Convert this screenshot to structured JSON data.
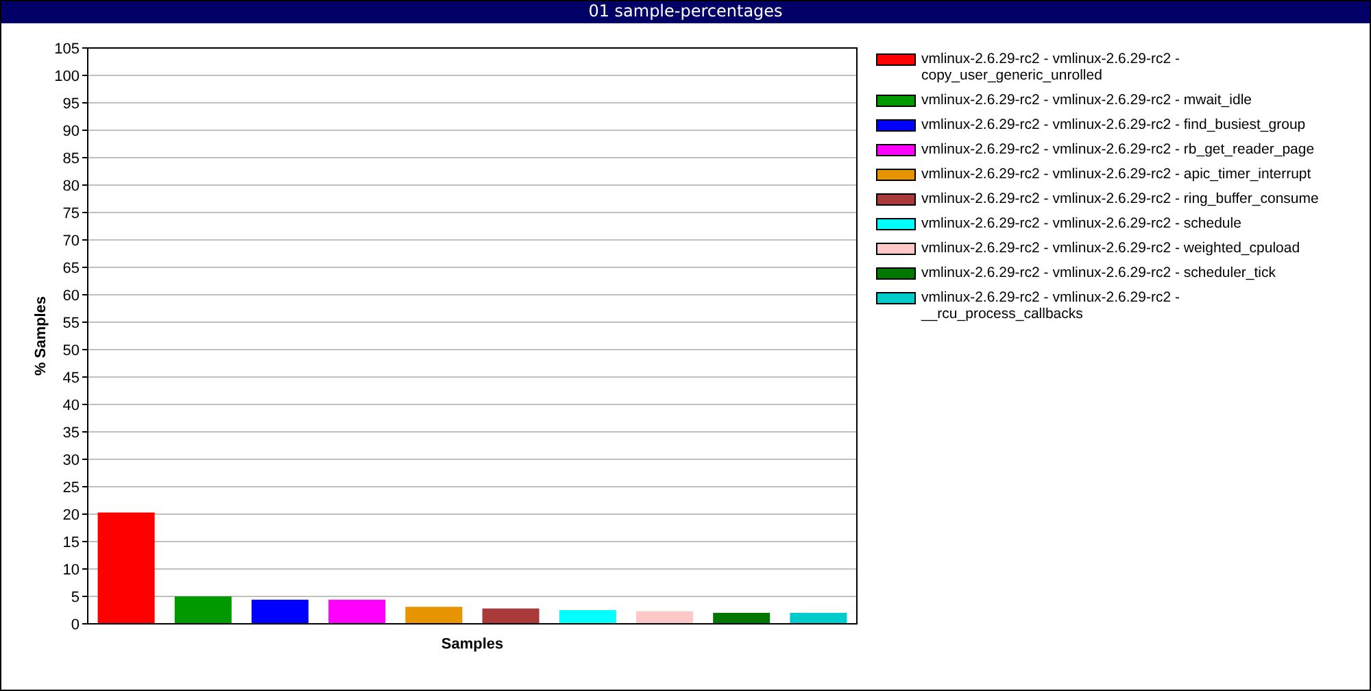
{
  "window": {
    "title": "01 sample-percentages"
  },
  "chart": {
    "chart_data": {
      "type": "bar",
      "grid": true,
      "xlabel": "Samples",
      "ylabel": "% Samples",
      "ylim": [
        0,
        105
      ],
      "yticks": [
        0,
        5,
        10,
        15,
        20,
        25,
        30,
        35,
        40,
        45,
        50,
        55,
        60,
        65,
        70,
        75,
        80,
        85,
        90,
        95,
        100,
        105
      ],
      "series": [
        {
          "name": "vmlinux-2.6.29-rc2 - vmlinux-2.6.29-rc2 - copy_user_generic_unrolled",
          "color": "#ff0000",
          "values": [
            20.3
          ]
        },
        {
          "name": "vmlinux-2.6.29-rc2 - vmlinux-2.6.29-rc2 - mwait_idle",
          "color": "#009900",
          "values": [
            5.0
          ]
        },
        {
          "name": "vmlinux-2.6.29-rc2 - vmlinux-2.6.29-rc2 - find_busiest_group",
          "color": "#0000ff",
          "values": [
            4.4
          ]
        },
        {
          "name": "vmlinux-2.6.29-rc2 - vmlinux-2.6.29-rc2 - rb_get_reader_page",
          "color": "#ff00ff",
          "values": [
            4.4
          ]
        },
        {
          "name": "vmlinux-2.6.29-rc2 - vmlinux-2.6.29-rc2 - apic_timer_interrupt",
          "color": "#e69500",
          "values": [
            3.1
          ]
        },
        {
          "name": "vmlinux-2.6.29-rc2 - vmlinux-2.6.29-rc2 - ring_buffer_consume",
          "color": "#aa3939",
          "values": [
            2.8
          ]
        },
        {
          "name": "vmlinux-2.6.29-rc2 - vmlinux-2.6.29-rc2 - schedule",
          "color": "#00ffff",
          "values": [
            2.5
          ]
        },
        {
          "name": "vmlinux-2.6.29-rc2 - vmlinux-2.6.29-rc2 - weighted_cpuload",
          "color": "#ffc8c8",
          "values": [
            2.3
          ]
        },
        {
          "name": "vmlinux-2.6.29-rc2 - vmlinux-2.6.29-rc2 - scheduler_tick",
          "color": "#007700",
          "values": [
            2.0
          ]
        },
        {
          "name": "vmlinux-2.6.29-rc2 - vmlinux-2.6.29-rc2 - __rcu_process_callbacks",
          "color": "#00cccc",
          "values": [
            2.0
          ]
        }
      ]
    }
  }
}
